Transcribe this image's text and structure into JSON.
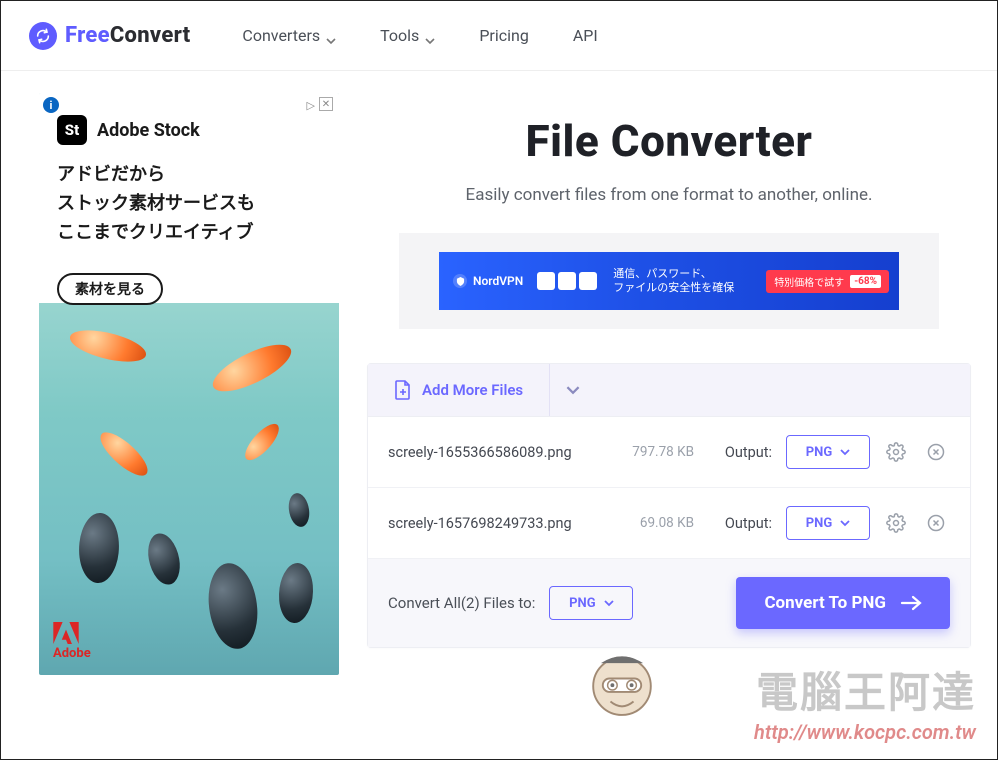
{
  "brand": {
    "free": "Free",
    "convert": "Convert"
  },
  "nav": {
    "converters": "Converters",
    "tools": "Tools",
    "pricing": "Pricing",
    "api": "API"
  },
  "hero": {
    "title": "File Converter",
    "subtitle": "Easily convert files from one format to another, online."
  },
  "sideAd": {
    "brandBadge": "St",
    "brand": "Adobe Stock",
    "line1": "アドビだから",
    "line2": "ストック素材サービスも",
    "line3": "ここまでクリエイティブ",
    "cta": "素材を見る",
    "footer": "Adobe",
    "infoIconLabel": "i",
    "adchoicesLabel": "▷",
    "closeLabel": "✕"
  },
  "banner": {
    "brand": "NordVPN",
    "line1": "通信、パスワード、",
    "line2": "ファイルの安全性を確保",
    "cta": "特別価格で試す",
    "discount": "-68%"
  },
  "panel": {
    "addMore": "Add More Files",
    "outputLabel": "Output:",
    "convertAllPrefix": "Convert All(",
    "convertAllSuffix": ") Files to:",
    "convertBtnPrefix": "Convert To ",
    "globalFormat": "PNG",
    "files": [
      {
        "name": "screely-1655366586089.png",
        "size": "797.78 KB",
        "format": "PNG"
      },
      {
        "name": "screely-1657698249733.png",
        "size": "69.08 KB",
        "format": "PNG"
      }
    ]
  },
  "watermark": {
    "big": "電腦王阿達",
    "url": "http://www.kocpc.com.tw"
  }
}
